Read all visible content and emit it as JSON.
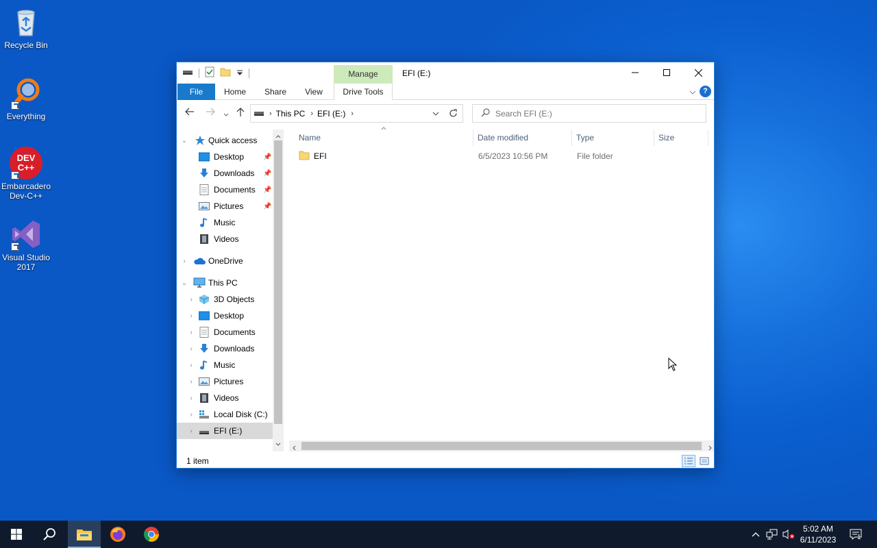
{
  "desktop": {
    "icons": [
      {
        "label": "Recycle Bin"
      },
      {
        "label": "Everything"
      },
      {
        "label": "Embarcadero Dev-C++",
        "logo_text": "DEV C++"
      },
      {
        "label": "Visual Studio 2017"
      }
    ]
  },
  "window": {
    "title": "EFI (E:)",
    "contextual_tab": "Manage",
    "ribbon_tabs": {
      "file": "File",
      "home": "Home",
      "share": "Share",
      "view": "View",
      "drive_tools": "Drive Tools"
    },
    "help_label": "?",
    "address": {
      "crumbs": [
        "This PC",
        "EFI (E:)"
      ]
    },
    "search": {
      "placeholder": "Search EFI (E:)"
    },
    "navigation": {
      "quick_access": {
        "label": "Quick access",
        "items": [
          "Desktop",
          "Downloads",
          "Documents",
          "Pictures",
          "Music",
          "Videos"
        ]
      },
      "onedrive": {
        "label": "OneDrive"
      },
      "this_pc": {
        "label": "This PC",
        "items": [
          "3D Objects",
          "Desktop",
          "Documents",
          "Downloads",
          "Music",
          "Pictures",
          "Videos",
          "Local Disk (C:)",
          "EFI (E:)"
        ]
      }
    },
    "columns": {
      "name": "Name",
      "date_modified": "Date modified",
      "type": "Type",
      "size": "Size"
    },
    "files": [
      {
        "name": "EFI",
        "date_modified": "6/5/2023 10:56 PM",
        "type": "File folder",
        "size": ""
      }
    ],
    "status": {
      "item_count": "1 item"
    }
  },
  "taskbar": {
    "clock": {
      "time": "5:02 AM",
      "date": "6/11/2023"
    },
    "notification_count": "1"
  },
  "colors": {
    "accent": "#1979ca",
    "manage_tab": "#cdeabb",
    "taskbar": "#0f1b2d",
    "folder": "#f7d774"
  }
}
